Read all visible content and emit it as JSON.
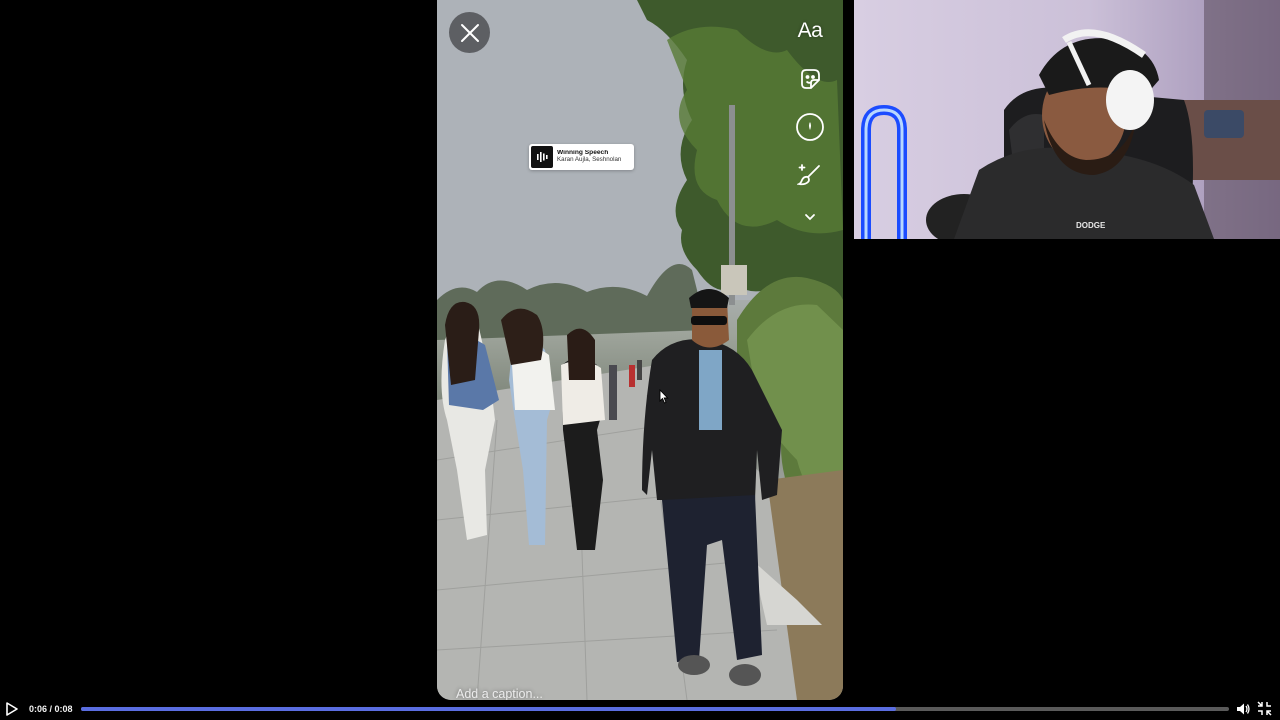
{
  "story_editor": {
    "tools": [
      {
        "name": "text-tool",
        "label": "Aa",
        "icon": "text-icon"
      },
      {
        "name": "sticker-tool",
        "icon": "sticker-icon"
      },
      {
        "name": "effects-tool",
        "icon": "effects-icon"
      },
      {
        "name": "draw-tool",
        "icon": "draw-brush-icon"
      },
      {
        "name": "more-tools",
        "icon": "chevron-down-icon"
      }
    ],
    "close_icon": "close-icon",
    "music_sticker": {
      "title": "Winning Speech",
      "artist": "Karan Aujla, Seshnolan",
      "icon": "audio-waveform-icon"
    },
    "caption_placeholder": "Add a caption..."
  },
  "player": {
    "time": "0:06 / 0:08",
    "progress_fraction": 0.71,
    "progress_color": "#5a6de0",
    "icons": [
      "play-icon",
      "volume-icon",
      "exit-fullscreen-icon"
    ]
  }
}
